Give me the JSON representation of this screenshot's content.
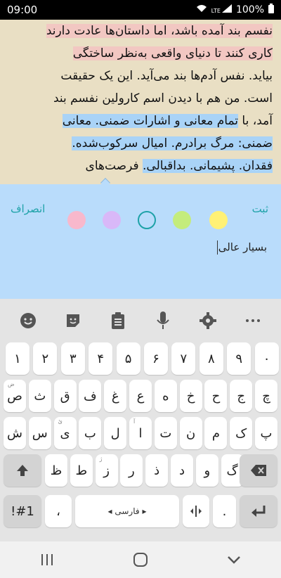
{
  "status_bar": {
    "time": "09:00",
    "network": "LTE",
    "battery": "100%"
  },
  "reader": {
    "lines": [
      {
        "segments": [
          {
            "text": "نفسم بند آمده باشد، اما داستان‌ها عادت دارند",
            "hl": "pink"
          }
        ]
      },
      {
        "segments": [
          {
            "text": "کاری کنند تا دنیای واقعی به‌نظر ساختگی",
            "hl": "pink"
          }
        ]
      },
      {
        "segments": [
          {
            "text": "بیاید. نفس آدم‌ها بند می‌آید. این یک حقیقت",
            "hl": ""
          }
        ]
      },
      {
        "segments": [
          {
            "text": "است. من هم با دیدن اسم کارولین نفسم بند",
            "hl": ""
          }
        ]
      },
      {
        "segments": [
          {
            "text": "آمد، با ",
            "hl": ""
          },
          {
            "text": "تمام معانی و اشارات ضمنی. معانی",
            "hl": "blue"
          }
        ]
      },
      {
        "segments": [
          {
            "text": "ضمنی: مرگ برادرم. امیال سرکوب‌شده.",
            "hl": "blue"
          }
        ]
      },
      {
        "segments": [
          {
            "text": "فقدان. پشیمانی. بداقبالی.",
            "hl": "blue"
          },
          {
            "text": "  فرصت‌های",
            "hl": ""
          }
        ]
      }
    ]
  },
  "note_panel": {
    "cancel_label": "انصراف",
    "save_label": "ثبت",
    "swatches": [
      "#f8b8cc",
      "#d9b8f8",
      "#ffffff",
      "#c4ec7c",
      "#fff176"
    ],
    "note_text": "بسیار عالی"
  },
  "keyboard": {
    "toolbar": [
      "emoji-icon",
      "sticker-icon",
      "clipboard-icon",
      "mic-icon",
      "settings-icon",
      "more-icon"
    ],
    "row_numbers": [
      "۱",
      "۲",
      "۳",
      "۴",
      "۵",
      "۶",
      "۷",
      "۸",
      "۹",
      "۰"
    ],
    "row1": [
      "ص",
      "ث",
      "ق",
      "ف",
      "غ",
      "ع",
      "ه",
      "خ",
      "ح",
      "ج",
      "چ"
    ],
    "row1_hints": [
      "ض",
      "",
      "",
      "",
      "",
      "",
      "",
      "",
      "",
      "",
      ""
    ],
    "row2": [
      "ش",
      "س",
      "ی",
      "ب",
      "ل",
      "ا",
      "ت",
      "ن",
      "م",
      "ک",
      "پ"
    ],
    "row2_hints": [
      "",
      "",
      "ئ",
      "",
      "",
      "آ",
      "",
      "",
      "",
      "",
      ""
    ],
    "row3": [
      "ظ",
      "ط",
      "ز",
      "ر",
      "ذ",
      "د",
      "و",
      "گ"
    ],
    "row3_hints": [
      "",
      "",
      "ژ",
      "",
      "",
      "",
      "",
      ""
    ],
    "symbols_label": "!#1",
    "comma_label": "،",
    "space_label": "فارسی",
    "period_label": "."
  }
}
